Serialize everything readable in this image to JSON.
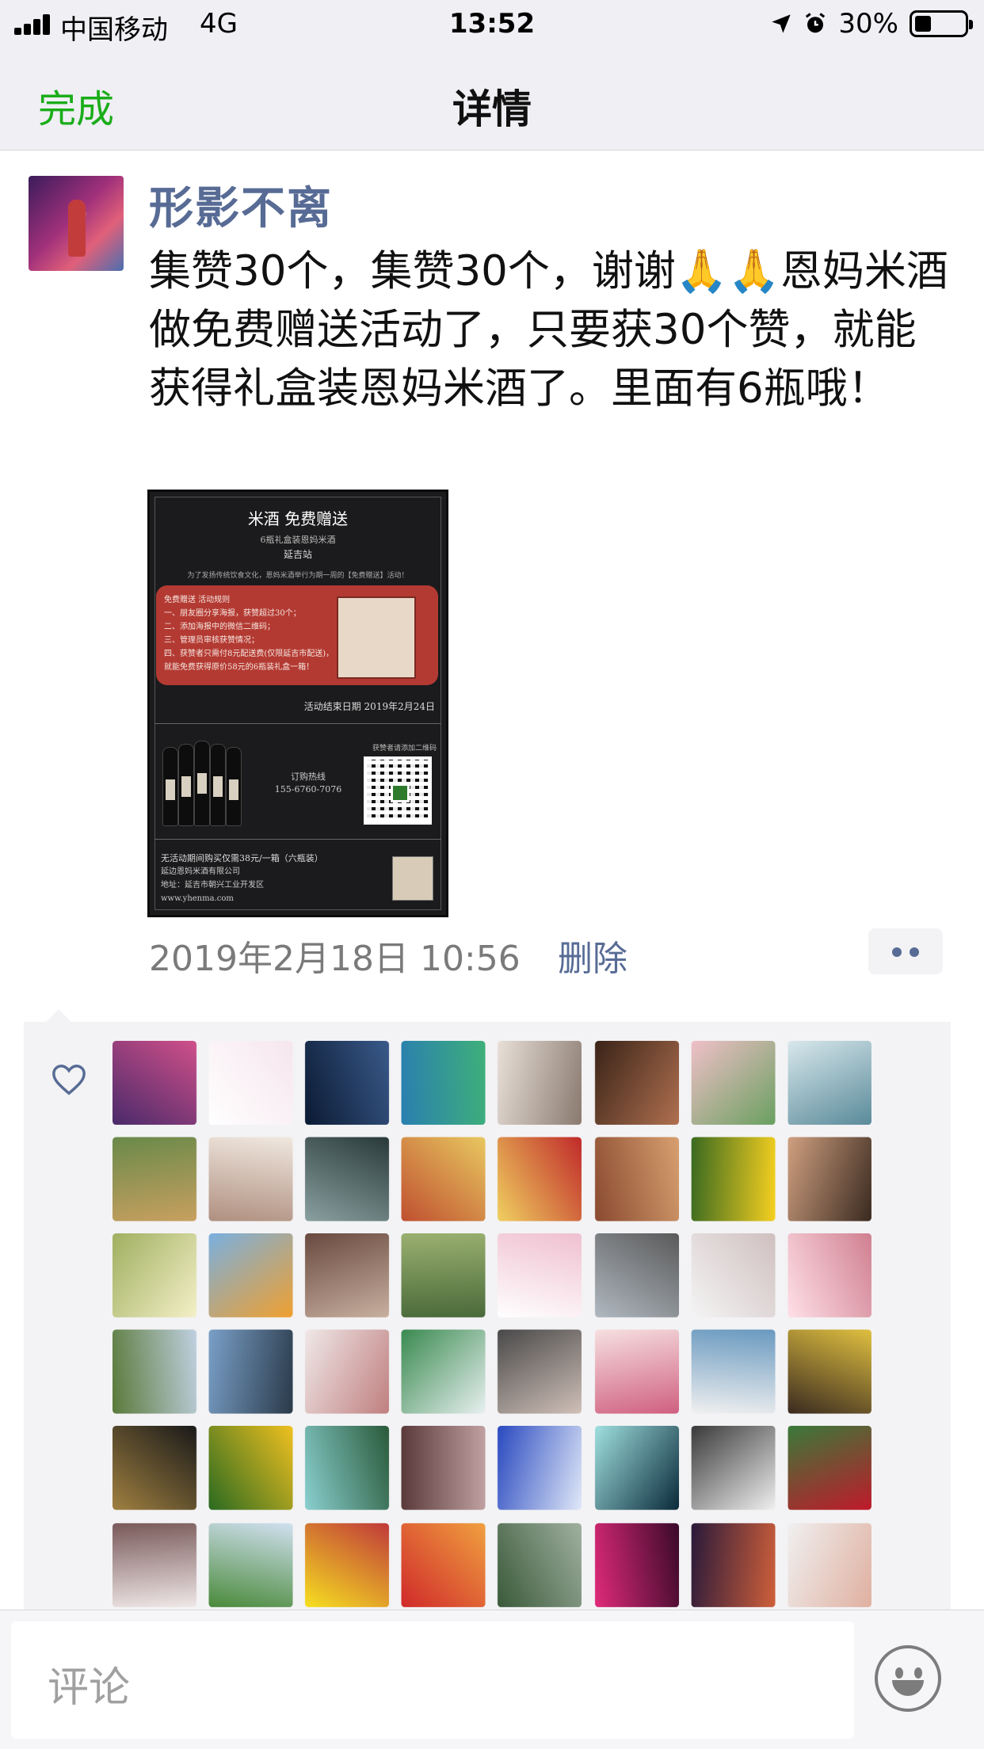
{
  "status_bar": {
    "carrier": "中国移动",
    "network": "4G",
    "time": "13:52",
    "battery": "30%"
  },
  "nav": {
    "done": "完成",
    "title": "详情"
  },
  "post": {
    "username": "形影不离",
    "text": "集赞30个，集赞30个，谢谢🙏🙏恩妈米酒做免费赠送活动了，只要获30个赞，就能获得礼盒装恩妈米酒了。里面有6瓶哦！",
    "timestamp": "2019年2月18日 10:56",
    "delete_label": "删除"
  },
  "poster": {
    "title": "米酒 免费赠送",
    "subtitle": "6瓶礼盒装恩妈米酒",
    "location": "延吉站",
    "intro": "为了发扬传统饮食文化，恩妈米酒举行为期一周的【免费赠送】活动！",
    "rules": [
      "免费赠送 活动规则",
      "一、朋友圈分享海报，获赞超过30个；",
      "二、添加海报中的微信二维码；",
      "三、管理员审核获赞情况；",
      "四、获赞者只需付8元配送费(仅限延吉市配送)，",
      "    就能免费获得原价58元的6瓶装礼盒一箱！"
    ],
    "end_date": "活动结束日期 2019年2月24日",
    "hotline_label": "订购热线",
    "hotline": "155-6760-7076",
    "qr_label": "获赞者请添加二维码",
    "footer": [
      "无活动期间购买仅需38元/一箱（六瓶装）",
      "延边恩妈米酒有限公司",
      "地址：延吉市朝兴工业开发区",
      "www.yhenma.com"
    ]
  },
  "likes": {
    "avatar_count": 48
  },
  "comment": {
    "placeholder": "评论"
  }
}
